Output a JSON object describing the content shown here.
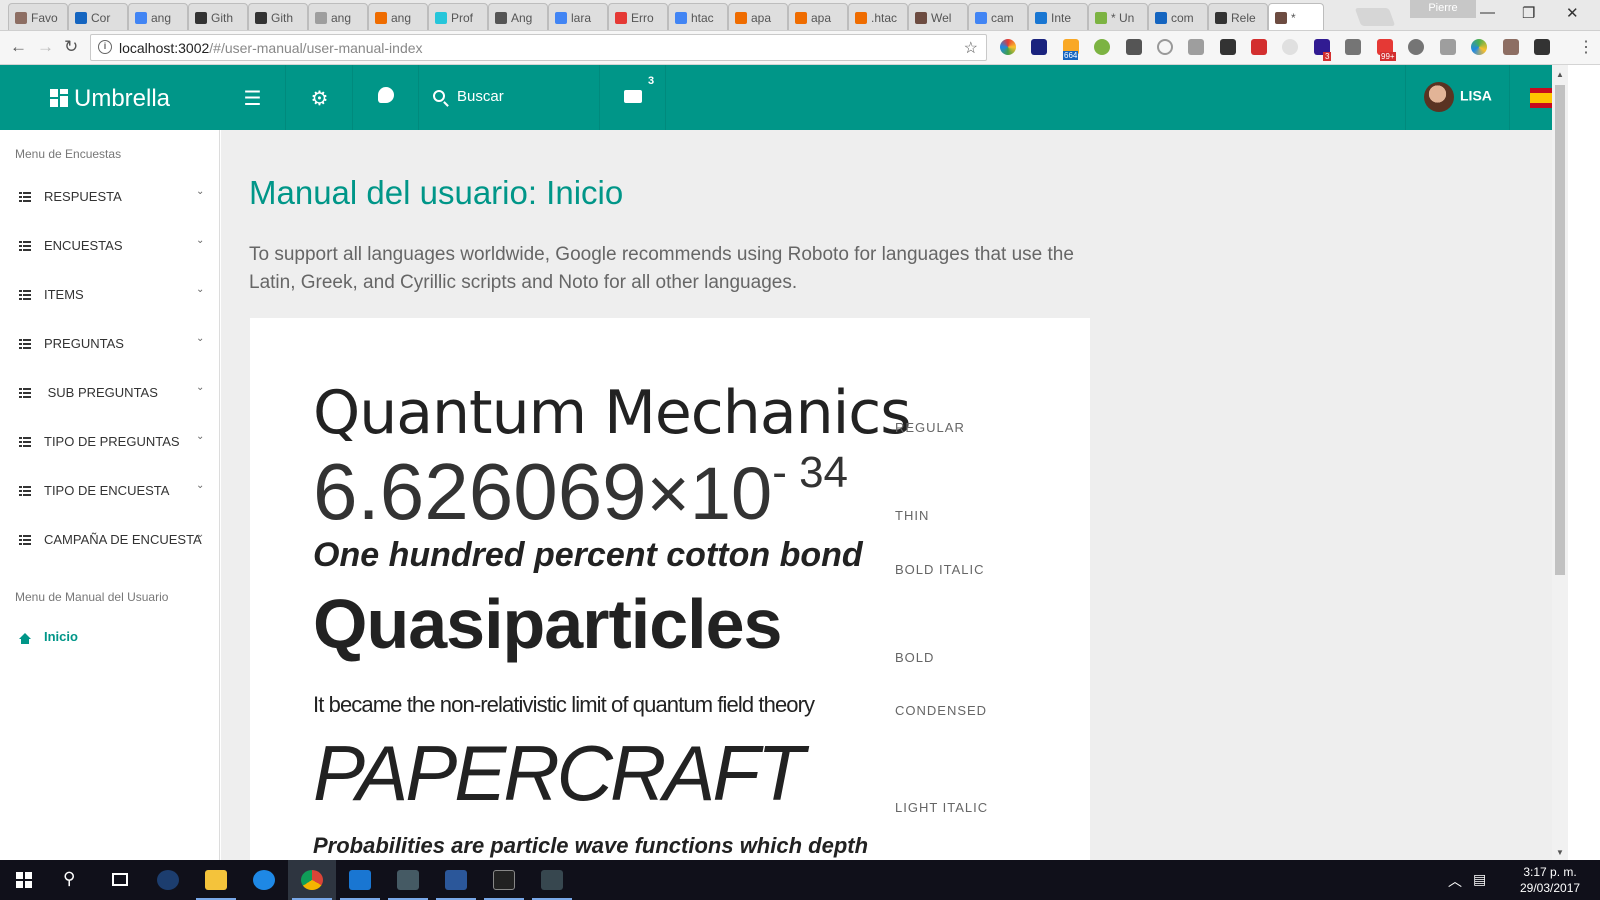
{
  "browser": {
    "tabs": [
      "Favo",
      "Cor",
      "ang",
      "Gith",
      "Gith",
      "ang",
      "ang",
      "Prof",
      "Ang",
      "lara",
      "Erro",
      "htac",
      "apa",
      "apa",
      ".htac",
      "Wel",
      "cam",
      "Inte",
      "* Un",
      "com",
      "Rele",
      "*"
    ],
    "profile": "Pierre",
    "url_host": "localhost:3002",
    "url_path": "/#/user-manual/user-manual-index",
    "ext_badges": [
      "664",
      "3",
      "99+"
    ]
  },
  "app": {
    "brand": "Umbrella",
    "search_label": "Buscar",
    "mail_count": "3",
    "user_name": "LISA",
    "accent_color": "#009688"
  },
  "sidebar": {
    "section1_title": "Menu de Encuestas",
    "items": [
      {
        "label": "RESPUESTA"
      },
      {
        "label": "ENCUESTAS"
      },
      {
        "label": "ITEMS"
      },
      {
        "label": "PREGUNTAS"
      },
      {
        "label": " SUB PREGUNTAS"
      },
      {
        "label": "TIPO DE PREGUNTAS"
      },
      {
        "label": "TIPO DE ENCUESTA"
      },
      {
        "label": "CAMPAÑA DE ENCUESTA"
      }
    ],
    "section2_title": "Menu de Manual del Usuario",
    "home_label": "Inicio"
  },
  "main": {
    "title": "Manual del usuario: Inicio",
    "intro": "To support all languages worldwide, Google recommends using Roboto for languages that use the Latin, Greek, and Cyrillic scripts and Noto for all other languages.",
    "specimens": [
      {
        "text": "Quantum Mechanics",
        "style": "REGULAR"
      },
      {
        "text_base": "6.626069",
        "text_times": "×10",
        "text_exp": "- 34",
        "style": "THIN"
      },
      {
        "text": "One hundred percent cotton bond",
        "style": "BOLD ITALIC"
      },
      {
        "text": "Quasiparticles",
        "style": "BOLD"
      },
      {
        "text": "It became the non-relativistic limit of quantum field theory",
        "style": "CONDENSED"
      },
      {
        "text": "PAPERCRAFT",
        "style": "LIGHT ITALIC"
      },
      {
        "text": "Probabilities are particle wave functions which depth"
      }
    ]
  },
  "taskbar": {
    "time": "3:17 p. m.",
    "date": "29/03/2017"
  }
}
